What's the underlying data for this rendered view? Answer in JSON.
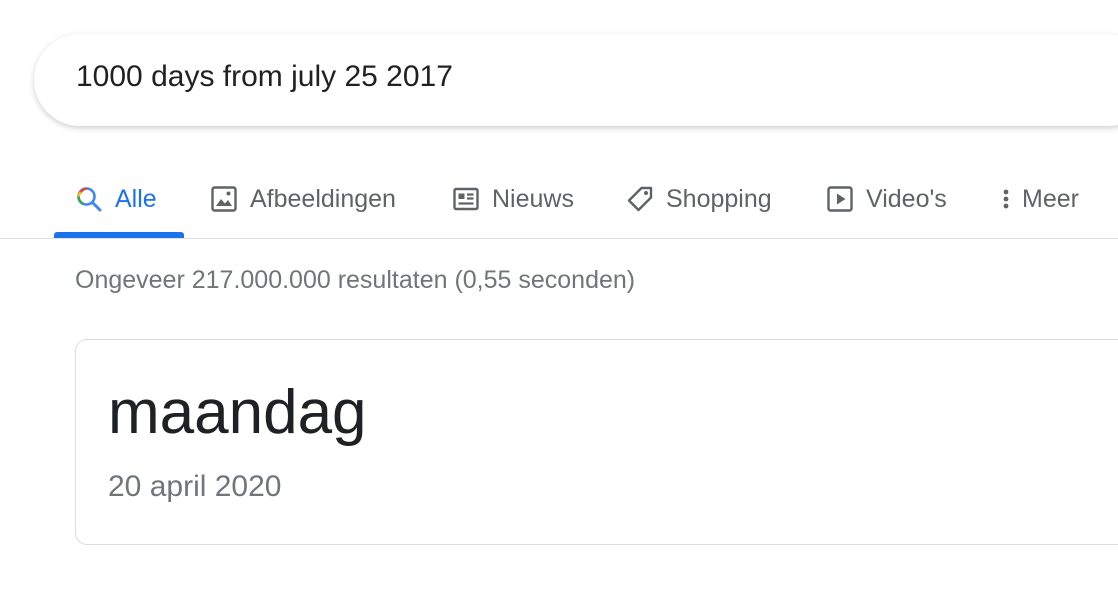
{
  "search": {
    "query": "1000 days from july 25 2017"
  },
  "tabs": [
    {
      "label": "Alle",
      "icon": "search-icon",
      "active": true
    },
    {
      "label": "Afbeeldingen",
      "icon": "image-icon",
      "active": false
    },
    {
      "label": "Nieuws",
      "icon": "news-icon",
      "active": false
    },
    {
      "label": "Shopping",
      "icon": "tag-icon",
      "active": false
    },
    {
      "label": "Video's",
      "icon": "play-icon",
      "active": false
    },
    {
      "label": "Meer",
      "icon": "more-vert-icon",
      "active": false
    }
  ],
  "results": {
    "stats": "Ongeveer 217.000.000 resultaten (0,55 seconden)"
  },
  "answer": {
    "day": "maandag",
    "date": "20 april 2020"
  },
  "colors": {
    "accent": "#1a73e8",
    "text_primary": "#202124",
    "text_secondary": "#5f6368",
    "text_muted": "#70757a"
  }
}
